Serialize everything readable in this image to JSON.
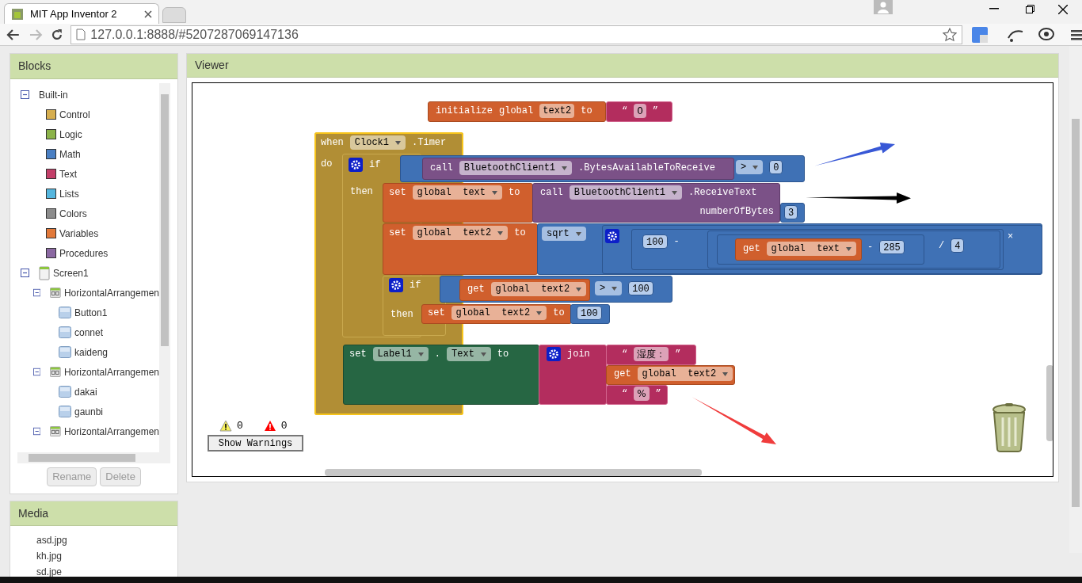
{
  "browser": {
    "tab_title": "MIT App Inventor 2",
    "url": "127.0.0.1:8888/#5207287069147136"
  },
  "blocks_panel": {
    "title": "Blocks",
    "tree": [
      {
        "label": "Built-in",
        "kind": "group",
        "expanded": true,
        "children": [
          {
            "label": "Control",
            "kind": "category",
            "color": "#d6ae4f"
          },
          {
            "label": "Logic",
            "kind": "category",
            "color": "#8cb34a"
          },
          {
            "label": "Math",
            "kind": "category",
            "color": "#4a7fc3"
          },
          {
            "label": "Text",
            "kind": "category",
            "color": "#c33f69"
          },
          {
            "label": "Lists",
            "kind": "category",
            "color": "#55b6de"
          },
          {
            "label": "Colors",
            "kind": "category",
            "color": "#8c8c8c"
          },
          {
            "label": "Variables",
            "kind": "category",
            "color": "#e2793a"
          },
          {
            "label": "Procedures",
            "kind": "category",
            "color": "#8b69a2"
          }
        ]
      },
      {
        "label": "Screen1",
        "kind": "screen",
        "expanded": true,
        "children": [
          {
            "label": "HorizontalArrangemen",
            "kind": "arrangement",
            "expanded": true,
            "children": [
              {
                "label": "Button1",
                "kind": "button"
              },
              {
                "label": "connet",
                "kind": "button"
              },
              {
                "label": "kaideng",
                "kind": "button"
              }
            ]
          },
          {
            "label": "HorizontalArrangemen",
            "kind": "arrangement",
            "expanded": true,
            "children": [
              {
                "label": "dakai",
                "kind": "button"
              },
              {
                "label": "gaunbi",
                "kind": "button"
              }
            ]
          },
          {
            "label": "HorizontalArrangemen",
            "kind": "arrangement",
            "expanded": true
          }
        ]
      }
    ],
    "buttons": [
      {
        "label": "Rename",
        "disabled": true
      },
      {
        "label": "Delete",
        "disabled": true
      }
    ]
  },
  "media_panel": {
    "title": "Media",
    "files": [
      "asd.jpg",
      "kh.jpg",
      "sd.jpe"
    ]
  },
  "viewer": {
    "title": "Viewer",
    "blocks": [
      {
        "kind": "variables",
        "selected": false,
        "lines": [
          {
            "parts": [
              {
                "kind": "label",
                "text": "initialize"
              },
              {
                "kind": "label",
                "text": "global"
              },
              {
                "kind": "name",
                "text": "text2"
              },
              {
                "kind": "label",
                "text": "to"
              }
            ]
          }
        ]
      },
      {
        "kind": "text",
        "selected": false,
        "lines": [
          {
            "parts": [
              {
                "kind": "label",
                "text": "“"
              },
              {
                "kind": "string",
                "text": "0"
              },
              {
                "kind": "label",
                "text": "”"
              }
            ]
          }
        ]
      },
      {
        "kind": "control",
        "selected": true,
        "lines": [
          {
            "parts": [
              {
                "kind": "label",
                "text": "when"
              },
              {
                "kind": "dropdown",
                "text": "Clock1"
              },
              {
                "kind": "label",
                "text": ".Timer"
              }
            ]
          },
          {
            "parts": [
              {
                "kind": "label",
                "text": "do"
              }
            ]
          }
        ],
        "blocks": [
          {
            "kind": "control",
            "selected": false,
            "lines": [
              {
                "parts": [
                  {
                    "kind": "gear"
                  },
                  {
                    "kind": "label",
                    "text": "if"
                  }
                ]
              },
              {
                "parts": [
                  {
                    "kind": "label",
                    "text": "then"
                  }
                ]
              }
            ],
            "blocks": [
              {
                "kind": "math",
                "selected": false,
                "lines": [
                  {
                    "parts": [
                      {
                        "kind": "dropdown",
                        "text": ">"
                      },
                      {
                        "kind": "number",
                        "text": "0"
                      }
                    ]
                  }
                ],
                "blocks": [
                  {
                    "kind": "procedure",
                    "selected": false,
                    "lines": [
                      {
                        "parts": [
                          {
                            "kind": "label",
                            "text": "call"
                          },
                          {
                            "kind": "dropdown",
                            "text": "BluetoothClient1"
                          },
                          {
                            "kind": "label",
                            "text": ".BytesAvailableToReceive"
                          }
                        ]
                      }
                    ]
                  }
                ]
              },
              {
                "kind": "variables",
                "selected": false,
                "lines": [
                  {
                    "parts": [
                      {
                        "kind": "label",
                        "text": "set"
                      },
                      {
                        "kind": "dropdown",
                        "text": "global  text"
                      },
                      {
                        "kind": "label",
                        "text": "to"
                      }
                    ]
                  }
                ],
                "blocks": [
                  {
                    "kind": "procedure",
                    "selected": false,
                    "lines": [
                      {
                        "parts": [
                          {
                            "kind": "label",
                            "text": "call"
                          },
                          {
                            "kind": "dropdown",
                            "text": "BluetoothClient1"
                          },
                          {
                            "kind": "label",
                            "text": ".ReceiveText"
                          }
                        ]
                      },
                      {
                        "parts": [
                          {
                            "kind": "label",
                            "text": "numberOfBytes"
                          }
                        ]
                      }
                    ],
                    "blocks": [
                      {
                        "kind": "math",
                        "selected": false,
                        "lines": [
                          {
                            "parts": [
                              {
                                "kind": "number",
                                "text": "3"
                              }
                            ]
                          }
                        ]
                      }
                    ]
                  }
                ]
              },
              {
                "kind": "variables",
                "selected": false,
                "lines": [
                  {
                    "parts": [
                      {
                        "kind": "label",
                        "text": "set"
                      },
                      {
                        "kind": "dropdown",
                        "text": "global  text2"
                      },
                      {
                        "kind": "label",
                        "text": "to"
                      }
                    ]
                  }
                ],
                "blocks": [
                  {
                    "kind": "math",
                    "selected": false,
                    "lines": [
                      {
                        "parts": [
                          {
                            "kind": "dropdown",
                            "text": "sqrt"
                          }
                        ]
                      }
                    ],
                    "blocks": [
                      {
                        "kind": "math",
                        "selected": false,
                        "lines": [
                          {
                            "parts": [
                              {
                                "kind": "gear"
                              }
                            ]
                          },
                          {
                            "parts": [
                              {
                                "kind": "label",
                                "text": "×"
                              }
                            ]
                          }
                        ],
                        "blocks": [
                          {
                            "kind": "math",
                            "selected": false,
                            "lines": [
                              {
                                "parts": [
                                  {
                                    "kind": "number",
                                    "text": "100"
                                  },
                                  {
                                    "kind": "label",
                                    "text": "-"
                                  }
                                ]
                              }
                            ],
                            "blocks": [
                              {
                                "kind": "math",
                                "selected": false,
                                "lines": [
                                  {
                                    "parts": [
                                      {
                                        "kind": "label",
                                        "text": "/"
                                      },
                                      {
                                        "kind": "number",
                                        "text": "4"
                                      }
                                    ]
                                  }
                                ],
                                "blocks": [
                                  {
                                    "kind": "math",
                                    "selected": false,
                                    "lines": [
                                      {
                                        "parts": [
                                          {
                                            "kind": "label",
                                            "text": "-"
                                          },
                                          {
                                            "kind": "number",
                                            "text": "285"
                                          }
                                        ]
                                      }
                                    ],
                                    "blocks": [
                                      {
                                        "kind": "variables",
                                        "selected": false,
                                        "lines": [
                                          {
                                            "parts": [
                                              {
                                                "kind": "label",
                                                "text": "get"
                                              },
                                              {
                                                "kind": "dropdown",
                                                "text": "global  text"
                                              }
                                            ]
                                          }
                                        ]
                                      }
                                    ]
                                  }
                                ]
                              }
                            ]
                          }
                        ]
                      }
                    ]
                  }
                ]
              },
              {
                "kind": "control",
                "selected": false,
                "lines": [
                  {
                    "parts": [
                      {
                        "kind": "gear"
                      },
                      {
                        "kind": "label",
                        "text": "if"
                      }
                    ]
                  },
                  {
                    "parts": [
                      {
                        "kind": "label",
                        "text": "then"
                      }
                    ]
                  }
                ],
                "blocks": [
                  {
                    "kind": "math",
                    "selected": false,
                    "lines": [
                      {
                        "parts": [
                          {
                            "kind": "dropdown",
                            "text": ">"
                          },
                          {
                            "kind": "number",
                            "text": "100"
                          }
                        ]
                      }
                    ],
                    "blocks": [
                      {
                        "kind": "variables",
                        "selected": false,
                        "lines": [
                          {
                            "parts": [
                              {
                                "kind": "label",
                                "text": "get"
                              },
                              {
                                "kind": "dropdown",
                                "text": "global  text2"
                              }
                            ]
                          }
                        ]
                      }
                    ]
                  },
                  {
                    "kind": "variables",
                    "selected": false,
                    "lines": [
                      {
                        "parts": [
                          {
                            "kind": "label",
                            "text": "set"
                          },
                          {
                            "kind": "dropdown",
                            "text": "global  text2"
                          },
                          {
                            "kind": "label",
                            "text": "to"
                          }
                        ]
                      }
                    ],
                    "blocks": [
                      {
                        "kind": "math",
                        "selected": false,
                        "lines": [
                          {
                            "parts": [
                              {
                                "kind": "number",
                                "text": "100"
                              }
                            ]
                          }
                        ]
                      }
                    ]
                  }
                ]
              }
            ]
          },
          {
            "kind": "setter",
            "selected": false,
            "lines": [
              {
                "parts": [
                  {
                    "kind": "label",
                    "text": "set"
                  },
                  {
                    "kind": "dropdown",
                    "text": "Label1"
                  },
                  {
                    "kind": "label",
                    "text": "."
                  },
                  {
                    "kind": "dropdown",
                    "text": "Text"
                  },
                  {
                    "kind": "label",
                    "text": "to"
                  }
                ]
              }
            ],
            "blocks": [
              {
                "kind": "text",
                "selected": false,
                "lines": [
                  {
                    "parts": [
                      {
                        "kind": "gear"
                      },
                      {
                        "kind": "label",
                        "text": "join"
                      }
                    ]
                  }
                ],
                "blocks": [
                  {
                    "kind": "text",
                    "selected": false,
                    "lines": [
                      {
                        "parts": [
                          {
                            "kind": "label",
                            "text": "“"
                          },
                          {
                            "kind": "string",
                            "text": "湿度："
                          },
                          {
                            "kind": "label",
                            "text": "”"
                          }
                        ]
                      }
                    ]
                  },
                  {
                    "kind": "variables",
                    "selected": false,
                    "lines": [
                      {
                        "parts": [
                          {
                            "kind": "label",
                            "text": "get"
                          },
                          {
                            "kind": "dropdown",
                            "text": "global  text2"
                          }
                        ]
                      }
                    ]
                  },
                  {
                    "kind": "text",
                    "selected": false,
                    "lines": [
                      {
                        "parts": [
                          {
                            "kind": "label",
                            "text": "“"
                          },
                          {
                            "kind": "string",
                            "text": "%"
                          },
                          {
                            "kind": "label",
                            "text": "”"
                          }
                        ]
                      }
                    ]
                  }
                ]
              }
            ]
          }
        ]
      }
    ],
    "arrows": [
      {
        "color": "#3858d6"
      },
      {
        "color": "#000000"
      },
      {
        "color": "#f03c3c"
      }
    ],
    "warnings": {
      "warning_count": "0",
      "error_count": "0",
      "button": "Show Warnings"
    }
  }
}
